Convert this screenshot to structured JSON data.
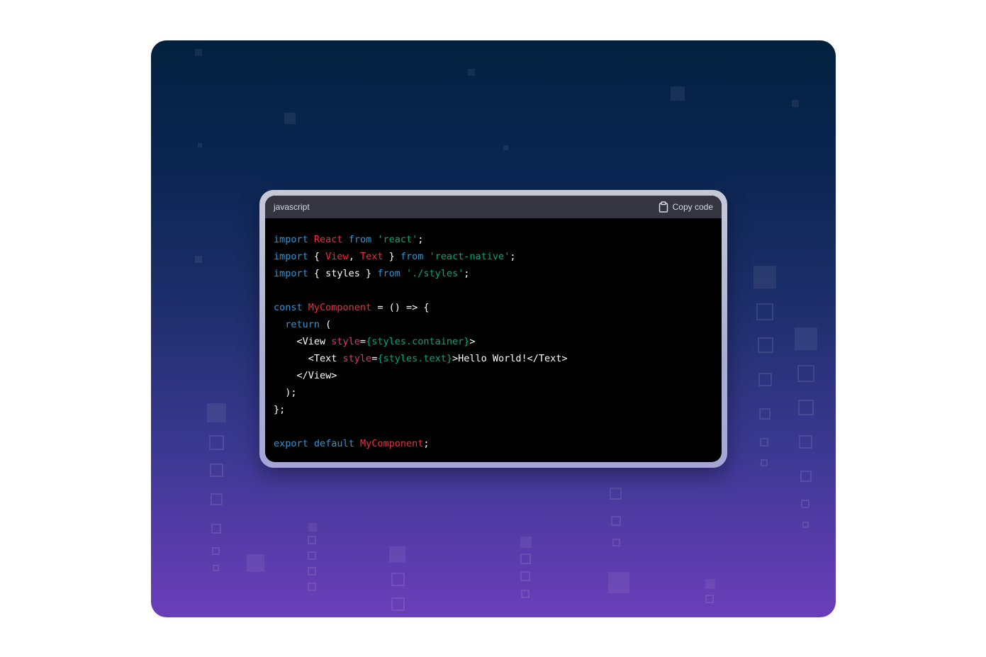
{
  "code_block": {
    "language": "javascript",
    "copy_label": "Copy code",
    "lines": [
      [
        {
          "t": "import",
          "c": "kw"
        },
        {
          "t": " ",
          "c": "pl"
        },
        {
          "t": "React",
          "c": "ty"
        },
        {
          "t": " ",
          "c": "pl"
        },
        {
          "t": "from",
          "c": "kw"
        },
        {
          "t": " ",
          "c": "pl"
        },
        {
          "t": "'react'",
          "c": "st"
        },
        {
          "t": ";",
          "c": "pl"
        }
      ],
      [
        {
          "t": "import",
          "c": "kw"
        },
        {
          "t": " { ",
          "c": "pl"
        },
        {
          "t": "View",
          "c": "ty"
        },
        {
          "t": ", ",
          "c": "pl"
        },
        {
          "t": "Text",
          "c": "ty"
        },
        {
          "t": " } ",
          "c": "pl"
        },
        {
          "t": "from",
          "c": "kw"
        },
        {
          "t": " ",
          "c": "pl"
        },
        {
          "t": "'react-native'",
          "c": "st"
        },
        {
          "t": ";",
          "c": "pl"
        }
      ],
      [
        {
          "t": "import",
          "c": "kw"
        },
        {
          "t": " { styles } ",
          "c": "pl"
        },
        {
          "t": "from",
          "c": "kw"
        },
        {
          "t": " ",
          "c": "pl"
        },
        {
          "t": "'./styles'",
          "c": "st"
        },
        {
          "t": ";",
          "c": "pl"
        }
      ],
      [],
      [
        {
          "t": "const",
          "c": "kw"
        },
        {
          "t": " ",
          "c": "pl"
        },
        {
          "t": "MyComponent",
          "c": "ty"
        },
        {
          "t": " = () => {",
          "c": "pl"
        }
      ],
      [
        {
          "t": "  ",
          "c": "pl"
        },
        {
          "t": "return",
          "c": "kw"
        },
        {
          "t": " (",
          "c": "pl"
        }
      ],
      [
        {
          "t": "    <View ",
          "c": "pl"
        },
        {
          "t": "style",
          "c": "id"
        },
        {
          "t": "=",
          "c": "pl"
        },
        {
          "t": "{styles.container}",
          "c": "st"
        },
        {
          "t": ">",
          "c": "pl"
        }
      ],
      [
        {
          "t": "      <Text ",
          "c": "pl"
        },
        {
          "t": "style",
          "c": "id"
        },
        {
          "t": "=",
          "c": "pl"
        },
        {
          "t": "{styles.text}",
          "c": "st"
        },
        {
          "t": ">Hello World!</Text>",
          "c": "pl"
        }
      ],
      [
        {
          "t": "    </View>",
          "c": "pl"
        }
      ],
      [
        {
          "t": "  );",
          "c": "pl"
        }
      ],
      [
        {
          "t": "};",
          "c": "pl"
        }
      ],
      [],
      [
        {
          "t": "export",
          "c": "kw"
        },
        {
          "t": " ",
          "c": "pl"
        },
        {
          "t": "default",
          "c": "kw"
        },
        {
          "t": " ",
          "c": "pl"
        },
        {
          "t": "MyComponent",
          "c": "ty"
        },
        {
          "t": ";",
          "c": "pl"
        }
      ]
    ]
  },
  "colors": {
    "keyword": "#2e95d3",
    "attribute": "#df3079",
    "identifier": "#f22c3d",
    "string": "#00a67d",
    "header_bg": "#343541",
    "code_bg": "#000000"
  },
  "icons": {
    "copy": "clipboard-icon"
  }
}
